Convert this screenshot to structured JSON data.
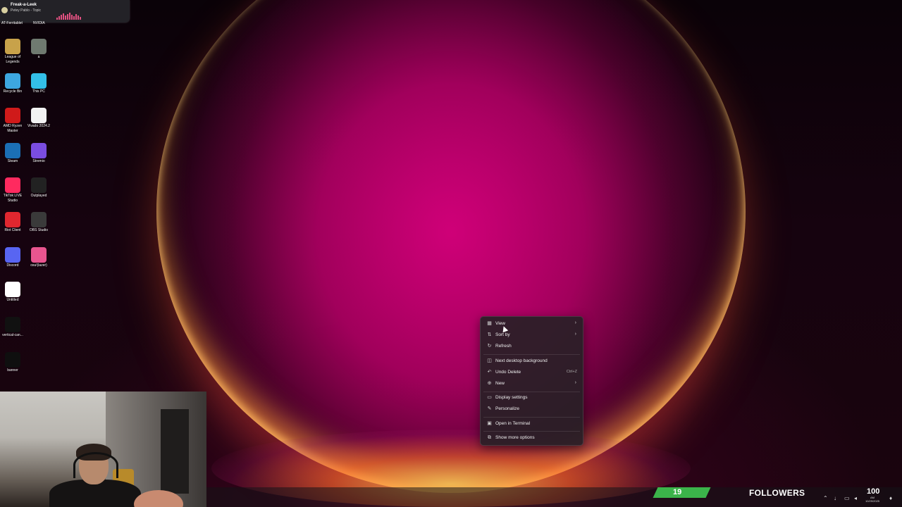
{
  "music": {
    "title": "Freak-a-Leek",
    "artist": "Petey Pablo - Topic"
  },
  "desktop": {
    "truncated_labels": [
      "AT-Ferritablet",
      "NVIDIA"
    ],
    "icons": [
      {
        "label": "League of Legends",
        "color": "#c8a24a",
        "icon": "league-icon"
      },
      {
        "label": "a",
        "color": "#6f7a70",
        "icon": "gpu-icon"
      },
      {
        "label": "Recycle Bin",
        "color": "#3da7e0",
        "icon": "recycle-bin-icon"
      },
      {
        "label": "This PC",
        "color": "#33c0e8",
        "icon": "monitor-icon"
      },
      {
        "label": "AMD Ryzen Master",
        "color": "#d01a1a",
        "icon": "ryzen-icon"
      },
      {
        "label": "Vivado 2024.2",
        "color": "#f2f2f2",
        "icon": "vivado-icon"
      },
      {
        "label": "Steam",
        "color": "#1b6fb5",
        "icon": "steam-icon"
      },
      {
        "label": "Stremio",
        "color": "#7a4de0",
        "icon": "stremio-icon"
      },
      {
        "label": "TikTok LIVE Studio",
        "color": "#ff2a5f",
        "icon": "tiktok-icon"
      },
      {
        "label": "Outplayed",
        "color": "#222222",
        "icon": "outplayed-icon"
      },
      {
        "label": "Riot Client",
        "color": "#e0272f",
        "icon": "riot-icon"
      },
      {
        "label": "OBS Studio",
        "color": "#3a3a3a",
        "icon": "obs-icon"
      },
      {
        "label": "Discord",
        "color": "#5865f2",
        "icon": "discord-icon"
      },
      {
        "label": "osu!(lazer)",
        "color": "#e8558f",
        "icon": "osu-icon"
      },
      {
        "label": "Untitled",
        "color": "#ffffff",
        "icon": "document-icon"
      },
      {
        "label": "vertical-can...",
        "color": "#111111",
        "icon": "image-file-icon"
      },
      {
        "label": "banner",
        "color": "#0f0f0f",
        "icon": "banner-file-icon"
      }
    ]
  },
  "context_menu": {
    "items": [
      {
        "label": "View",
        "icon": "▦",
        "submenu": true
      },
      {
        "label": "Sort by",
        "icon": "⇅",
        "submenu": true
      },
      {
        "label": "Refresh",
        "icon": "↻"
      },
      {
        "label": "Next desktop background",
        "icon": "◫"
      },
      {
        "label": "Undo Delete",
        "icon": "↶",
        "shortcut": "Ctrl+Z"
      },
      {
        "label": "New",
        "icon": "⊕",
        "submenu": true
      },
      {
        "label": "Display settings",
        "icon": "▭"
      },
      {
        "label": "Personalize",
        "icon": "✎"
      },
      {
        "label": "Open in Terminal",
        "icon": "▣"
      },
      {
        "label": "Show more options",
        "icon": "⧉"
      }
    ]
  },
  "stream_overlay": {
    "followers_count": "19",
    "followers_label": "FOLLOWERS",
    "followers_goal": "100"
  },
  "taskbar": {
    "clock_time": "AM",
    "clock_date": "10/29/2025"
  }
}
